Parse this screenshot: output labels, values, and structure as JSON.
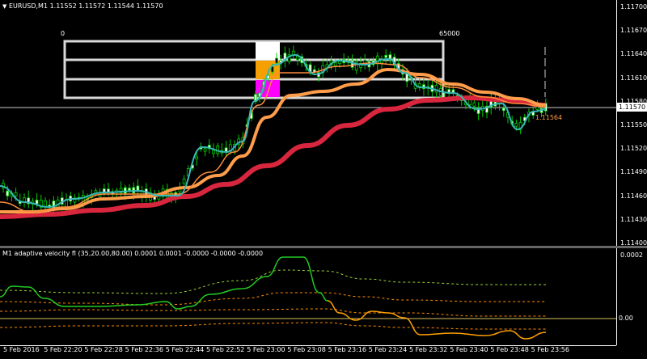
{
  "main_panel": {
    "title": "EURUSD,M1  1.11552 1.11572 1.11544 1.11570",
    "menu_icon": "triangle-down-icon",
    "scale_left_label": "0",
    "scale_right_label": "65000",
    "price_labels": [
      "1.11700",
      "1.11670",
      "1.11640",
      "1.11610",
      "1.11580",
      "1.11550",
      "1.11520",
      "1.11490",
      "1.11460",
      "1.11430",
      "1.11400"
    ],
    "current_price": "1.11570",
    "inline_price_label": "1.11564",
    "bar_colors": [
      "#ffffff",
      "#f5a000",
      "#ff00ff"
    ],
    "colors": {
      "fast_ma": "#38b8b8",
      "mid_ma": "#ff8c3a",
      "slow_ma": "#ff9d4a",
      "trend_ma": "#d7263d",
      "candle": "#00cc00",
      "grid": "#cccccc"
    }
  },
  "osc_panel": {
    "title": "M1 adaptive velocity fl (35,20.00,80.00) 0.0001 0.0001 -0.0000 -0.0000 -0.0000",
    "top_label": "0.0002",
    "zero_label": "0.00",
    "colors": {
      "rising": "#22cc22",
      "falling": "#ffa000",
      "band_upper": "#9bd036",
      "band_lower": "#ff8c00",
      "zero_line": "#d4c060"
    }
  },
  "time_axis": {
    "labels": [
      "5 Feb 2016",
      "5 Feb 22:20",
      "5 Feb 22:28",
      "5 Feb 22:36",
      "5 Feb 22:44",
      "5 Feb 22:52",
      "5 Feb 23:00",
      "5 Feb 23:08",
      "5 Feb 23:16",
      "5 Feb 23:24",
      "5 Feb 23:32",
      "5 Feb 23:40",
      "5 Feb 23:48",
      "5 Feb 23:56"
    ]
  }
}
